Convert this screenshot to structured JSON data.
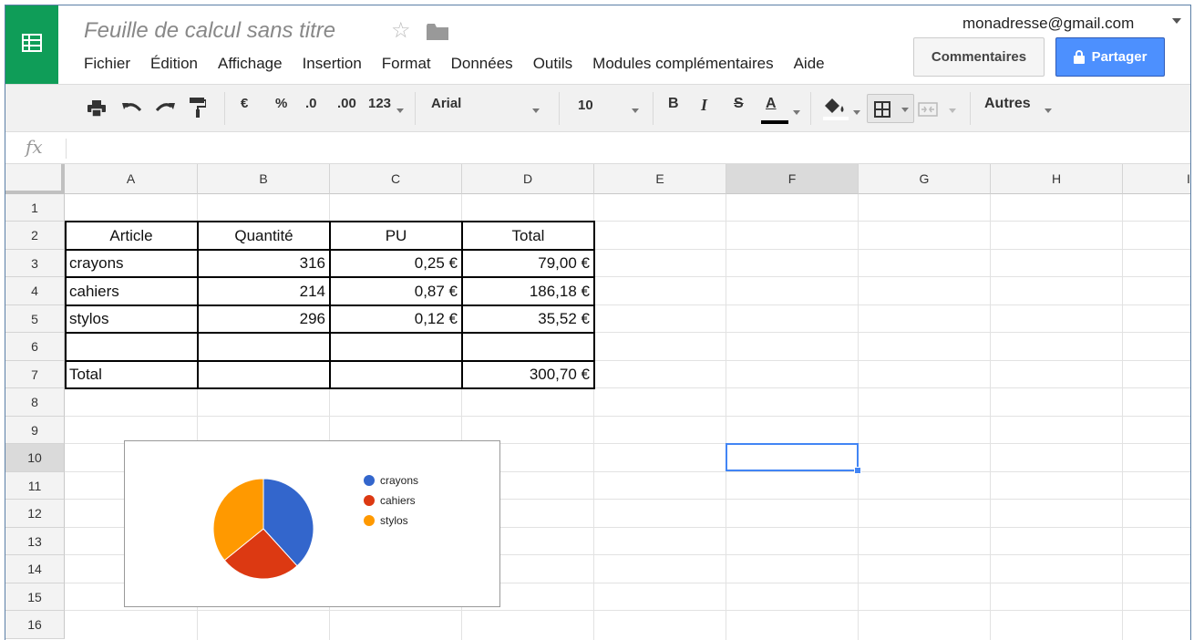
{
  "header": {
    "title": "Feuille de calcul sans titre",
    "account": "monadresse@gmail.com",
    "comments_label": "Commentaires",
    "share_label": "Partager"
  },
  "menu": [
    "Fichier",
    "Édition",
    "Affichage",
    "Insertion",
    "Format",
    "Données",
    "Outils",
    "Modules complémentaires",
    "Aide"
  ],
  "toolbar": {
    "currency": "€",
    "percent": "%",
    "dec_decrease": ".0",
    "dec_increase": ".00",
    "more_formats": "123",
    "font": "Arial",
    "font_size": "10",
    "bold": "B",
    "italic": "I",
    "strike": "S",
    "text_color": "A",
    "more": "Autres"
  },
  "columns": [
    "A",
    "B",
    "C",
    "D",
    "E",
    "F",
    "G",
    "H",
    "I"
  ],
  "rows": [
    "1",
    "2",
    "3",
    "4",
    "5",
    "6",
    "7",
    "8",
    "9",
    "10",
    "11",
    "12",
    "13",
    "14",
    "15",
    "16"
  ],
  "table": {
    "headers": [
      "Article",
      "Quantité",
      "PU",
      "Total"
    ],
    "rows": [
      [
        "crayons",
        "316",
        "0,25 €",
        "79,00 €"
      ],
      [
        "cahiers",
        "214",
        "0,87 €",
        "186,18 €"
      ],
      [
        "stylos",
        "296",
        "0,12 €",
        "35,52 €"
      ]
    ],
    "total_label": "Total",
    "total_value": "300,70 €"
  },
  "chart_data": {
    "type": "pie",
    "categories": [
      "crayons",
      "cahiers",
      "stylos"
    ],
    "values": [
      316,
      214,
      296
    ],
    "colors": [
      "#3366cc",
      "#dc3912",
      "#ff9900"
    ],
    "legend": "right"
  },
  "selected_cell": "F10"
}
